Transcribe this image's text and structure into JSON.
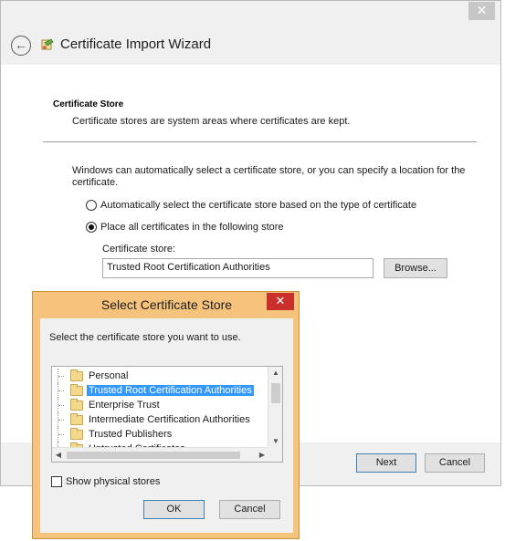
{
  "wizard": {
    "window_title": "Certificate Import Wizard",
    "close_glyph": "✕",
    "back_glyph": "←",
    "section_title": "Certificate Store",
    "section_desc": "Certificate stores are system areas where certificates are kept.",
    "intro": "Windows can automatically select a certificate store, or you can specify a location for the certificate.",
    "radio_auto": "Automatically select the certificate store based on the type of certificate",
    "radio_manual": "Place all certificates in the following store",
    "store_label": "Certificate store:",
    "store_value": "Trusted Root Certification Authorities",
    "browse_label": "Browse...",
    "next_label": "Next",
    "cancel_label": "Cancel"
  },
  "dialog": {
    "title": "Select Certificate Store",
    "close_glyph": "✕",
    "prompt": "Select the certificate store you want to use.",
    "items": [
      {
        "label": "Personal",
        "selected": false
      },
      {
        "label": "Trusted Root Certification Authorities",
        "selected": true
      },
      {
        "label": "Enterprise Trust",
        "selected": false
      },
      {
        "label": "Intermediate Certification Authorities",
        "selected": false
      },
      {
        "label": "Trusted Publishers",
        "selected": false
      },
      {
        "label": "Untrusted Certificates",
        "selected": false
      }
    ],
    "show_physical": "Show physical stores",
    "ok_label": "OK",
    "cancel_label": "Cancel"
  },
  "colors": {
    "selection": "#3399ff",
    "dialog_frame": "#f6c37c",
    "close_red": "#c9302c"
  }
}
